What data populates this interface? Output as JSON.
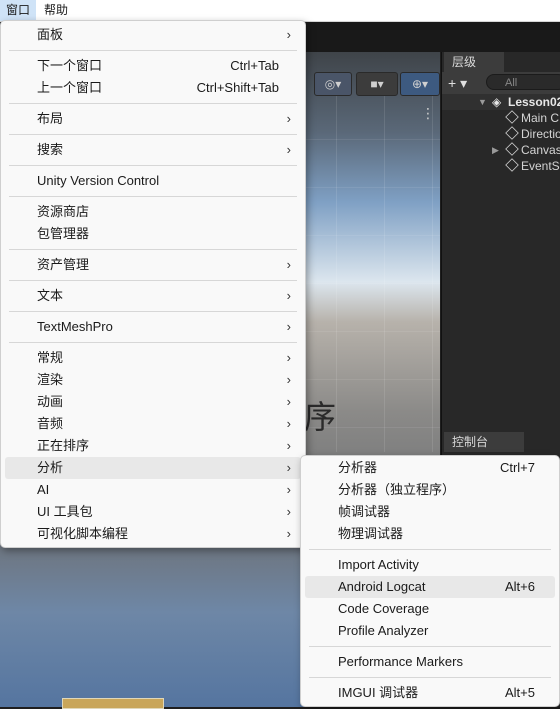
{
  "menubar": {
    "window": "窗口",
    "help": "帮助"
  },
  "hierarchy": {
    "tab": "层级",
    "search_placeholder": "All",
    "scene": "Lesson02",
    "items": [
      "Main C",
      "Directio",
      "Canvas",
      "EventSy"
    ]
  },
  "console": {
    "tab": "控制台"
  },
  "scene": {
    "glyph": "序"
  },
  "main_menu": {
    "panels": "面板",
    "next_window": "下一个窗口",
    "next_window_sc": "Ctrl+Tab",
    "prev_window": "上一个窗口",
    "prev_window_sc": "Ctrl+Shift+Tab",
    "layout": "布局",
    "search": "搜索",
    "uvc": "Unity Version Control",
    "asset_store": "资源商店",
    "package_manager": "包管理器",
    "asset_management": "资产管理",
    "text": "文本",
    "textmeshpro": "TextMeshPro",
    "general": "常规",
    "rendering": "渲染",
    "animation": "动画",
    "audio": "音频",
    "sequencing": "正在排序",
    "analysis": "分析",
    "ai": "AI",
    "ui_toolkit": "UI 工具包",
    "visual_scripting": "可视化脚本编程"
  },
  "sub_menu": {
    "profiler": "分析器",
    "profiler_sc": "Ctrl+7",
    "profiler_standalone": "分析器（独立程序）",
    "frame_debugger": "帧调试器",
    "physics_debugger": "物理调试器",
    "import_activity": "Import Activity",
    "android_logcat": "Android Logcat",
    "android_logcat_sc": "Alt+6",
    "code_coverage": "Code Coverage",
    "profile_analyzer": "Profile Analyzer",
    "performance_markers": "Performance Markers",
    "imgui_debugger": "IMGUI 调试器",
    "imgui_debugger_sc": "Alt+5"
  },
  "colors": {
    "highlight": "#e8e8e8",
    "menu_bg": "#f9f9f9",
    "active_menubar": "#cfe3f7"
  }
}
